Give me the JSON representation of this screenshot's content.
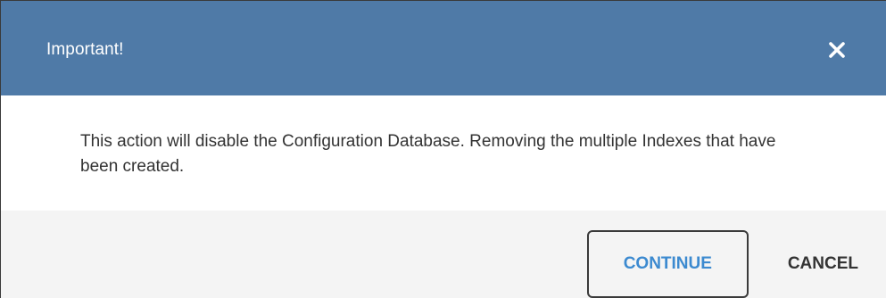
{
  "dialog": {
    "title": "Important!",
    "message": "This action will disable the Configuration Database. Removing the multiple Indexes that have been created.",
    "close_icon": "close-icon",
    "continue_label": "CONTINUE",
    "cancel_label": "CANCEL"
  },
  "colors": {
    "header_bg": "#4f7aa7",
    "continue_text": "#3c8ad0",
    "footer_bg": "#f4f4f4"
  }
}
